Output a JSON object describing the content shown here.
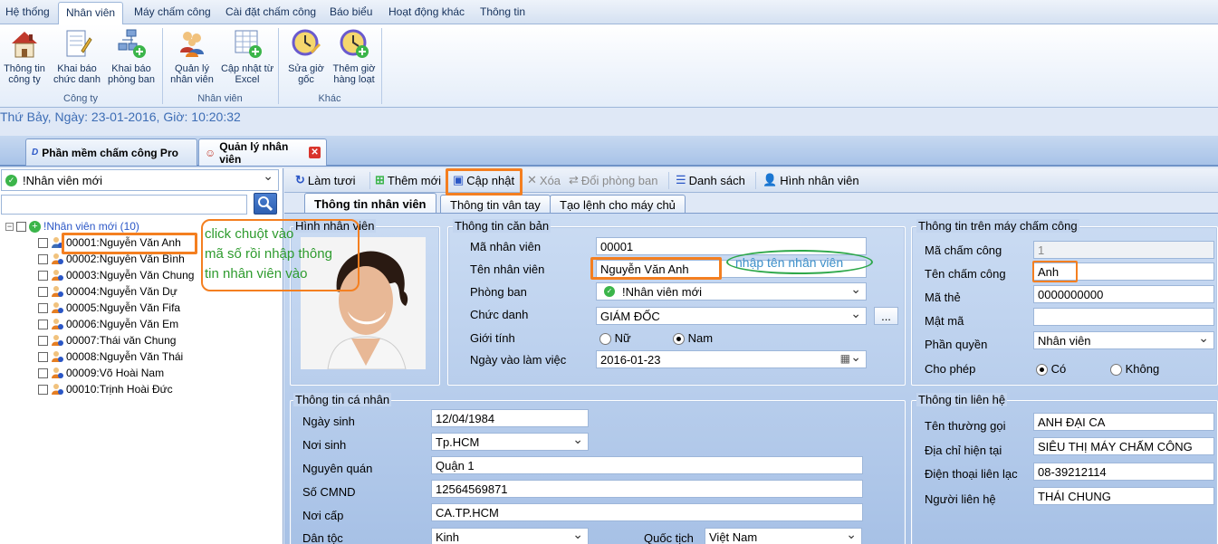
{
  "menu": {
    "tabs": [
      "Hệ thống",
      "Nhân viên",
      "Máy chấm công",
      "Cài đặt chấm công",
      "Báo biểu",
      "Hoạt động khác",
      "Thông tin"
    ]
  },
  "ribbon": {
    "buttons": [
      {
        "l1": "Thông tin",
        "l2": "công ty"
      },
      {
        "l1": "Khai báo",
        "l2": "chức danh"
      },
      {
        "l1": "Khai báo",
        "l2": "phòng ban"
      },
      {
        "l1": "Quản lý",
        "l2": "nhân viên"
      },
      {
        "l1": "Cập nhật từ",
        "l2": "Excel"
      },
      {
        "l1": "Sửa giờ",
        "l2": "gốc"
      },
      {
        "l1": "Thêm giờ",
        "l2": "hàng loạt"
      }
    ],
    "groups": [
      "Công ty",
      "Nhân viên",
      "Khác"
    ]
  },
  "status_line": "Thứ Bảy, Ngày: 23-01-2016, Giờ: 10:20:32",
  "doc_tabs": [
    "Phần mềm chấm công Pro",
    "Quản lý nhân viên"
  ],
  "left": {
    "department": "!Nhân viên mới",
    "tree_root": "!Nhân viên mới (10)",
    "employees": [
      "00001:Nguyễn Văn Anh",
      "00002:Nguyễn Văn Bình",
      "00003:Nguyễn Văn Chung",
      "00004:Nguyễn Văn Dự",
      "00005:Nguyễn Văn Fifa",
      "00006:Nguyễn Văn Em",
      "00007:Thái văn Chung",
      "00008:Nguyễn Văn Thái",
      "00009:Võ Hoài Nam",
      "00010:Trịnh Hoài Đức"
    ]
  },
  "toolbar": {
    "refresh": "Làm tươi",
    "add": "Thêm mới",
    "update": "Cập nhật",
    "delete": "Xóa",
    "change_dept": "Đổi phòng ban",
    "list": "Danh sách",
    "photo": "Hình nhân viên"
  },
  "content_tabs": [
    "Thông tin nhân viên",
    "Thông tin vân tay",
    "Tạo lệnh cho máy chủ"
  ],
  "photo_legend": "Hình nhân viên",
  "basic": {
    "legend": "Thông tin căn bản",
    "code_label": "Mã nhân viên",
    "code": "00001",
    "name_label": "Tên nhân viên",
    "name": "Nguyễn Văn Anh",
    "dept_label": "Phòng ban",
    "dept": "!Nhân viên mới",
    "title_label": "Chức danh",
    "title": "GIÁM ĐỐC",
    "title_btn": "...",
    "gender_label": "Giới tính",
    "female": "Nữ",
    "male": "Nam",
    "start_label": "Ngày vào làm việc",
    "start": "2016-01-23"
  },
  "machine": {
    "legend": "Thông tin trên máy chấm công",
    "id_label": "Mã chấm công",
    "id": "1",
    "name_label": "Tên chấm công",
    "name": "Anh",
    "card_label": "Mã thẻ",
    "card": "0000000000",
    "pwd_label": "Mật mã",
    "pwd": "",
    "role_label": "Phần quyền",
    "role": "Nhân viên",
    "allow_label": "Cho phép",
    "yes": "Có",
    "no": "Không"
  },
  "personal": {
    "legend": "Thông tin cá nhân",
    "dob_label": "Ngày sinh",
    "dob": "12/04/1984",
    "pob_label": "Nơi sinh",
    "pob": "Tp.HCM",
    "hometown_label": "Nguyên quán",
    "hometown": "Quận 1",
    "idno_label": "Số CMND",
    "idno": "12564569871",
    "issued_label": "Nơi cấp",
    "issued": "CA.TP.HCM",
    "ethnic_label": "Dân tộc",
    "ethnic": "Kinh",
    "nation_label": "Quốc tịch",
    "nation": "Việt Nam"
  },
  "contact": {
    "legend": "Thông tin liên hệ",
    "nick_label": "Tên thường gọi",
    "nick": "ANH ĐẠI CA",
    "addr_label": "Địa chỉ hiện tại",
    "addr": "SIÊU THỊ MÁY CHẤM CÔNG",
    "phone_label": "Điện thoại liên lạc",
    "phone": "08-39212114",
    "person_label": "Người liên hệ",
    "person": "THÁI CHUNG"
  },
  "annotations": {
    "click_l1": "click chuột vào",
    "click_l2": "mã số rồi nhập thông",
    "click_l3": "tin nhân viên vào",
    "name_hint": "nhập tên nhân viên"
  },
  "colors": {
    "annot_orange": "#f47f20",
    "annot_green": "#2e9b2e",
    "link_blue": "#2a56c6"
  }
}
